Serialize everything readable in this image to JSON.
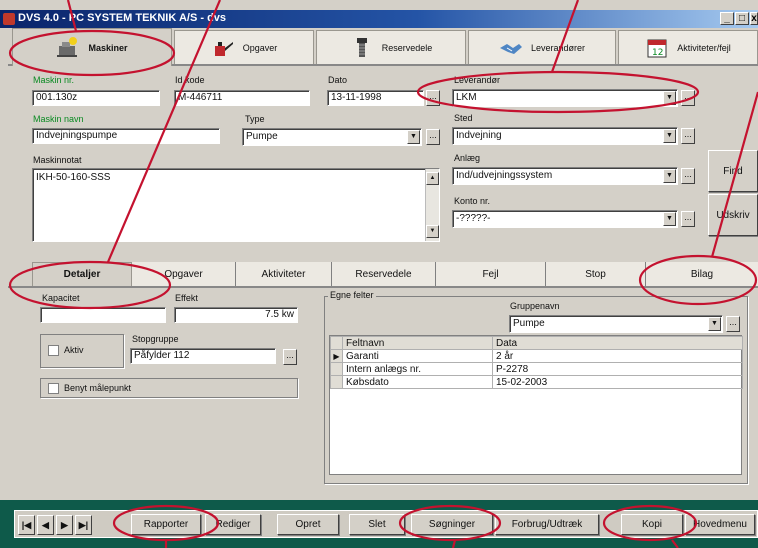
{
  "window": {
    "title": "DVS 4.0 - PC SYSTEM TEKNIK A/S - dvs",
    "min": "_",
    "max": "□",
    "close": "x"
  },
  "main_tabs": [
    {
      "label": "Maskiner",
      "icon": "machine-icon",
      "active": true
    },
    {
      "label": "Opgaver",
      "icon": "oil-can-icon"
    },
    {
      "label": "Reservedele",
      "icon": "spare-part-icon"
    },
    {
      "label": "Leverandører",
      "icon": "handshake-icon"
    },
    {
      "label": "Aktiviteter/fejl",
      "icon": "calendar-icon"
    }
  ],
  "form": {
    "maskin_nr": {
      "label": "Maskin nr.",
      "value": "001.130z"
    },
    "id_kode": {
      "label": "Id kode",
      "value": "M-446711"
    },
    "dato": {
      "label": "Dato",
      "value": "13-11-1998"
    },
    "maskin_navn": {
      "label": "Maskin navn",
      "value": "Indvejningspumpe"
    },
    "type": {
      "label": "Type",
      "value": "Pumpe"
    },
    "maskinnotat": {
      "label": "Maskinnotat",
      "value": "IKH-50-160-SSS"
    },
    "leverandor": {
      "label": "Leverandør",
      "value": "LKM"
    },
    "sted": {
      "label": "Sted",
      "value": "Indvejning"
    },
    "anlaeg": {
      "label": "Anlæg",
      "value": "Ind/udvejningssystem"
    },
    "konto": {
      "label": "Konto nr.",
      "value": "-?????-"
    },
    "dots": "..."
  },
  "side_buttons": {
    "find": "Find",
    "udskriv": "Udskriv"
  },
  "sub_tabs": [
    "Detaljer",
    "Opgaver",
    "Aktiviteter",
    "Reservedele",
    "Fejl",
    "Stop",
    "Bilag"
  ],
  "details": {
    "kapacitet": {
      "label": "Kapacitet",
      "value": ""
    },
    "effekt": {
      "label": "Effekt",
      "value": "7.5 kw"
    },
    "aktiv": "Aktiv",
    "stopgruppe": {
      "label": "Stopgruppe",
      "value": "Påfylder 112"
    },
    "maalepunkt": "Benyt målepunkt"
  },
  "egne_felter": {
    "title": "Egne felter",
    "gruppenavn": {
      "label": "Gruppenavn",
      "value": "Pumpe"
    },
    "columns": [
      "Feltnavn",
      "Data"
    ],
    "rows": [
      [
        "Garanti",
        "2 år"
      ],
      [
        "Intern anlægs nr.",
        "P-2278"
      ],
      [
        "Købsdato",
        "15-02-2003"
      ]
    ]
  },
  "toolbar": {
    "nav": [
      "|◀",
      "◀",
      "▶",
      "▶|"
    ],
    "buttons": [
      "Rapporter",
      "Rediger",
      "Opret",
      "Slet",
      "Søgninger",
      "Forbrug/Udtræk",
      "Kopi",
      "Hovedmenu"
    ]
  },
  "colors": {
    "annotation": "#c4122f",
    "toolbar_bg": "#0e5a4a",
    "title_bar": "#0a246a"
  }
}
